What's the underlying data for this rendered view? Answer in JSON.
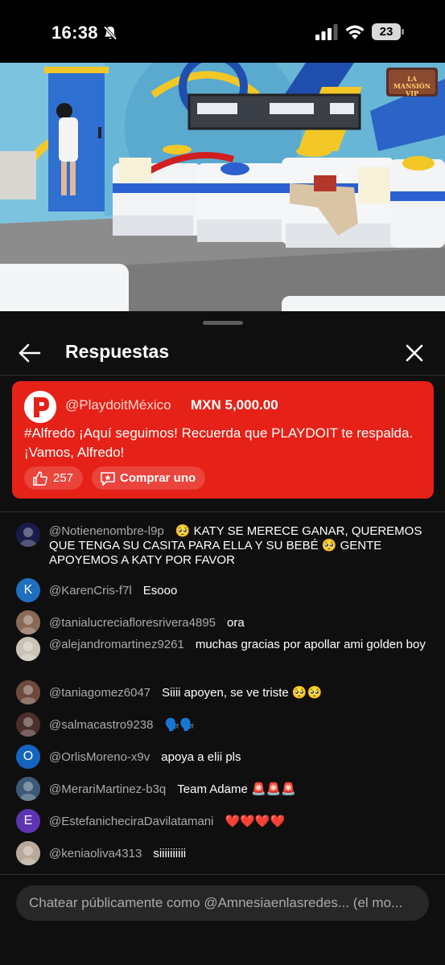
{
  "status_bar": {
    "time": "16:38",
    "battery": "23"
  },
  "video": {
    "logo_text": "LA MANSIÓN VIP"
  },
  "sheet": {
    "title": "Respuestas",
    "back_icon": "arrow-left-icon",
    "close_icon": "close-icon"
  },
  "super_chat": {
    "avatar_letter": "P",
    "author": "@PlaydoitMéxico",
    "amount": "MXN 5,000.00",
    "message": "#Alfredo ¡Aquí seguimos! Recuerda que PLAYDOIT te respalda. ¡Vamos, Alfredo!",
    "likes": "257",
    "buy_label": "Comprar uno",
    "color": "#e62117"
  },
  "comments": [
    {
      "author": "@Notienenombre-l9p",
      "text": "🥺 KATY SE MERECE GANAR, QUEREMOS QUE TENGA SU CASITA PARA ELLA Y SU BEBÉ 🥺 GENTE APOYEMOS A KATY POR FAVOR",
      "avatar": "image",
      "avatar_color": "#1b1b4a"
    },
    {
      "author": "@KarenCris-f7l",
      "text": "Esooo",
      "avatar": "K",
      "avatar_color": "#1e6fc0"
    },
    {
      "author": "@tanialucreciafloresrivera4895",
      "text": "ora",
      "avatar": "image",
      "avatar_color": "#8a6a55"
    },
    {
      "author": "@alejandromartinez9261",
      "text": "muchas gracias por apollar ami golden boy",
      "avatar": "image",
      "avatar_color": "#c9c3b5"
    },
    {
      "author": "@taniagomez6047",
      "text": "Siiii apoyen, se ve triste 🥺🥺",
      "avatar": "image",
      "avatar_color": "#6e4a3c"
    },
    {
      "author": "@salmacastro9238",
      "text": "🗣️🗣️",
      "avatar": "image",
      "avatar_color": "#4a2f2a"
    },
    {
      "author": "@OrlisMoreno-x9v",
      "text": "apoya a elii pls",
      "avatar": "O",
      "avatar_color": "#1565c0"
    },
    {
      "author": "@MerariMartinez-b3q",
      "text": "Team Adame 🚨🚨🚨",
      "avatar": "image",
      "avatar_color": "#3c5a78"
    },
    {
      "author": "@EstefanicheciraDavilatamani",
      "text": "❤️❤️❤️❤️",
      "avatar": "E",
      "avatar_color": "#5e35b1"
    },
    {
      "author": "@keniaoliva4313",
      "text": "siiiiiiiiii",
      "avatar": "image",
      "avatar_color": "#b8a99a"
    }
  ],
  "chat_input": {
    "placeholder": "Chatear públicamente como @Amnesiaenlasredes... (el mo..."
  }
}
